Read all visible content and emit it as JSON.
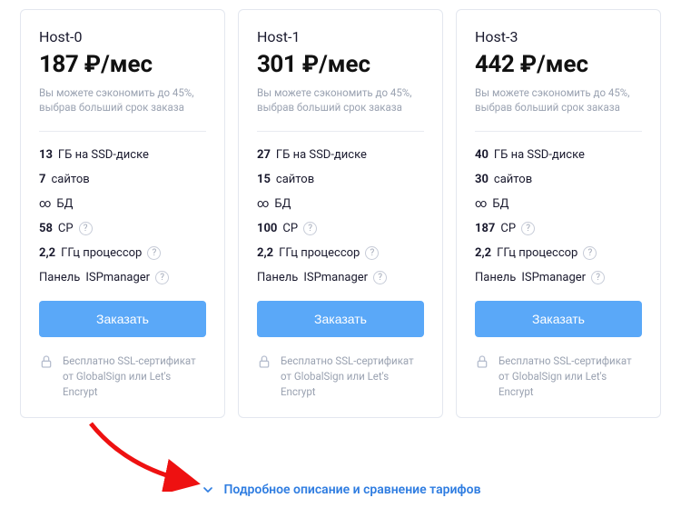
{
  "per_month": "/мес",
  "currency": "₽",
  "savings_note": "Вы можете сэкономить до 45%, выбрав больший срок заказа",
  "spec_labels": {
    "ssd_suffix": "ГБ на SSD-диске",
    "sites_suffix": "сайтов",
    "db_label": "БД",
    "cp_label": "CP",
    "cpu_suffix": "ГГц процессор",
    "panel_prefix": "Панель",
    "panel_name": "ISPmanager"
  },
  "order_label": "Заказать",
  "ssl_note": "Бесплатно SSL-сертификат от GlobalSign или Let's Encrypt",
  "compare_label": "Подробное описание и сравнение тарифов",
  "plans": [
    {
      "name": "Host-0",
      "price": "187",
      "ssd": "13",
      "sites": "7",
      "db": "∞",
      "cp": "58",
      "cpu": "2,2"
    },
    {
      "name": "Host-1",
      "price": "301",
      "ssd": "27",
      "sites": "15",
      "db": "∞",
      "cp": "100",
      "cpu": "2,2"
    },
    {
      "name": "Host-3",
      "price": "442",
      "ssd": "40",
      "sites": "30",
      "db": "∞",
      "cp": "187",
      "cpu": "2,2"
    }
  ]
}
